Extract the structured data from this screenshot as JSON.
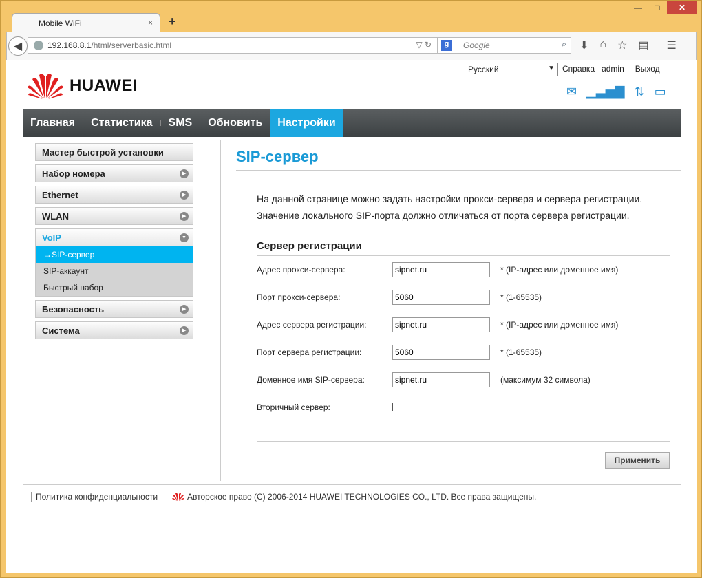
{
  "browser": {
    "tab_title": "Mobile WiFi",
    "tab_close": "×",
    "new_tab": "+",
    "url_host": "192.168.8.1",
    "url_path": "/html/serverbasic.html",
    "search_placeholder": "Google",
    "min": "—",
    "max": "□",
    "close": "✕"
  },
  "header": {
    "language": "Русский",
    "links": [
      "Справка",
      "admin",
      "Выход"
    ],
    "brand": "HUAWEI"
  },
  "nav": {
    "items": [
      "Главная",
      "Статистика",
      "SMS",
      "Обновить",
      "Настройки"
    ],
    "active_index": 4
  },
  "sidebar": {
    "quick_setup": "Мастер быстрой установки",
    "dialup": "Набор номера",
    "ethernet": "Ethernet",
    "wlan": "WLAN",
    "voip": "VoIP",
    "voip_items": [
      "SIP-сервер",
      "SIP-аккаунт",
      "Быстрый набор"
    ],
    "security": "Безопасность",
    "system": "Система"
  },
  "main": {
    "title": "SIP-сервер",
    "intro_1": "На данной странице можно задать настройки прокси-сервера и сервера регистрации.",
    "intro_2": "Значение локального SIP-порта должно отличаться от порта сервера регистрации.",
    "section": "Сервер регистрации",
    "fields": [
      {
        "label": "Адрес прокси-сервера:",
        "value": "sipnet.ru",
        "hint": "* (IP-адрес или доменное имя)"
      },
      {
        "label": "Порт прокси-сервера:",
        "value": "5060",
        "hint": "* (1-65535)"
      },
      {
        "label": "Адрес сервера регистрации:",
        "value": "sipnet.ru",
        "hint": "* (IP-адрес или доменное имя)"
      },
      {
        "label": "Порт сервера регистрации:",
        "value": "5060",
        "hint": "* (1-65535)"
      },
      {
        "label": "Доменное имя SIP-сервера:",
        "value": "sipnet.ru",
        "hint": "(максимум 32 символа)"
      }
    ],
    "secondary_label": "Вторичный сервер:",
    "secondary_checked": false,
    "apply": "Применить"
  },
  "footer": {
    "privacy": "Политика конфиденциальности",
    "copyright": "Авторское право (C) 2006-2014 HUAWEI TECHNOLOGIES CO., LTD. Все права защищены."
  },
  "colors": {
    "accent": "#1ca7e0",
    "brand_red": "#e02020"
  }
}
